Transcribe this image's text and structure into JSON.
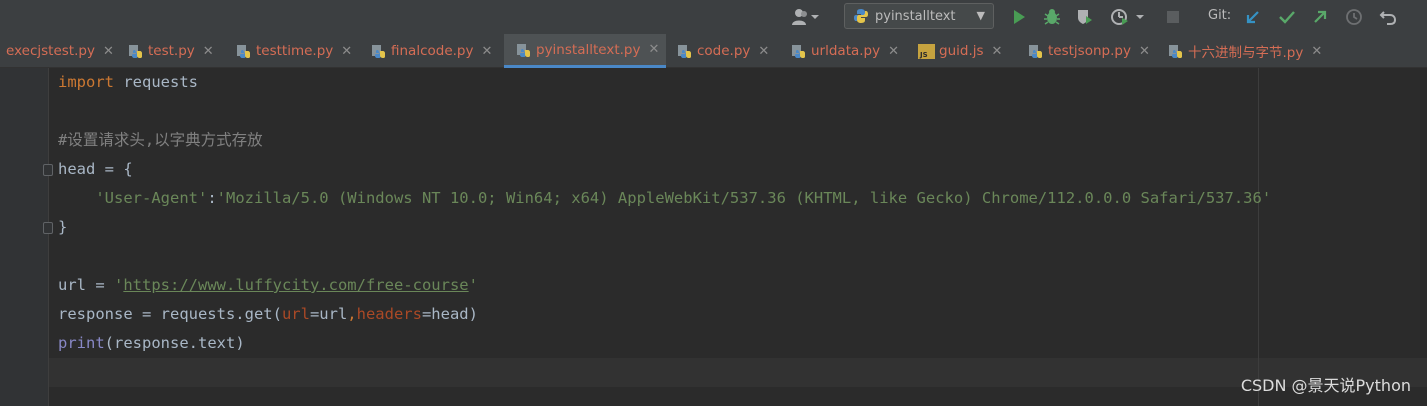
{
  "toolbar": {
    "run_config": {
      "label": "pyinstalltext",
      "icon": "python-icon"
    },
    "git_label": "Git:",
    "icons": {
      "user": "user-icon",
      "run": "run-icon",
      "debug": "bug-icon",
      "coverage": "coverage-icon",
      "profile": "profile-icon",
      "stop": "stop-icon",
      "git_update": "git-update-icon",
      "git_commit": "git-commit-icon",
      "git_push": "git-push-icon",
      "history": "history-icon",
      "rollback": "rollback-icon"
    },
    "colors": {
      "run": "#499c54",
      "debug": "#6a9955",
      "git_update": "#3592c4",
      "git_commit": "#59a869",
      "git_push": "#59a869"
    }
  },
  "tabs": [
    {
      "label": "execjstest.py",
      "type": "python",
      "active": false
    },
    {
      "label": "test.py",
      "type": "python",
      "active": false
    },
    {
      "label": "testtime.py",
      "type": "python",
      "active": false
    },
    {
      "label": "finalcode.py",
      "type": "python",
      "active": false
    },
    {
      "label": "pyinstalltext.py",
      "type": "python",
      "active": true
    },
    {
      "label": "code.py",
      "type": "python",
      "active": false
    },
    {
      "label": "urldata.py",
      "type": "python",
      "active": false
    },
    {
      "label": "guid.js",
      "type": "js",
      "active": false
    },
    {
      "label": "testjsonp.py",
      "type": "python",
      "active": false
    },
    {
      "label": "十六进制与字节.py",
      "type": "python",
      "active": false
    }
  ],
  "tab_close_glyph": "✕",
  "js_badge": "JS",
  "editor": {
    "line1": {
      "kw": "import",
      "rest": " requests"
    },
    "line3": "#设置请求头,以字典方式存放",
    "line4": "head = {",
    "line5": {
      "indent": "    ",
      "key": "'User-Agent'",
      "colon": ":",
      "value": "'Mozilla/5.0 (Windows NT 10.0; Win64; x64) AppleWebKit/537.36 (KHTML, like Gecko) Chrome/112.0.0.0 Safari/537.36'"
    },
    "line6": "}",
    "line8": {
      "prefix": "url = ",
      "q1": "'",
      "link": "https://www.luffycity.com/free-course",
      "q2": "'"
    },
    "line9": {
      "a": "response = requests.get(",
      "p1": "url",
      "b": "=url",
      "comma": ",",
      "p2": "headers",
      "c": "=head)"
    },
    "line10": {
      "builtin": "print",
      "rest": "(response.text)"
    }
  },
  "watermark": "CSDN @景天说Python",
  "colors": {
    "background": "#2b2b2b",
    "keyword": "#cc7832",
    "string": "#6a8759",
    "comment": "#808080",
    "param": "#aa4926",
    "builtin": "#8888c6",
    "tab_text": "#d56d55",
    "active_tab_underline": "#4a88c7"
  }
}
